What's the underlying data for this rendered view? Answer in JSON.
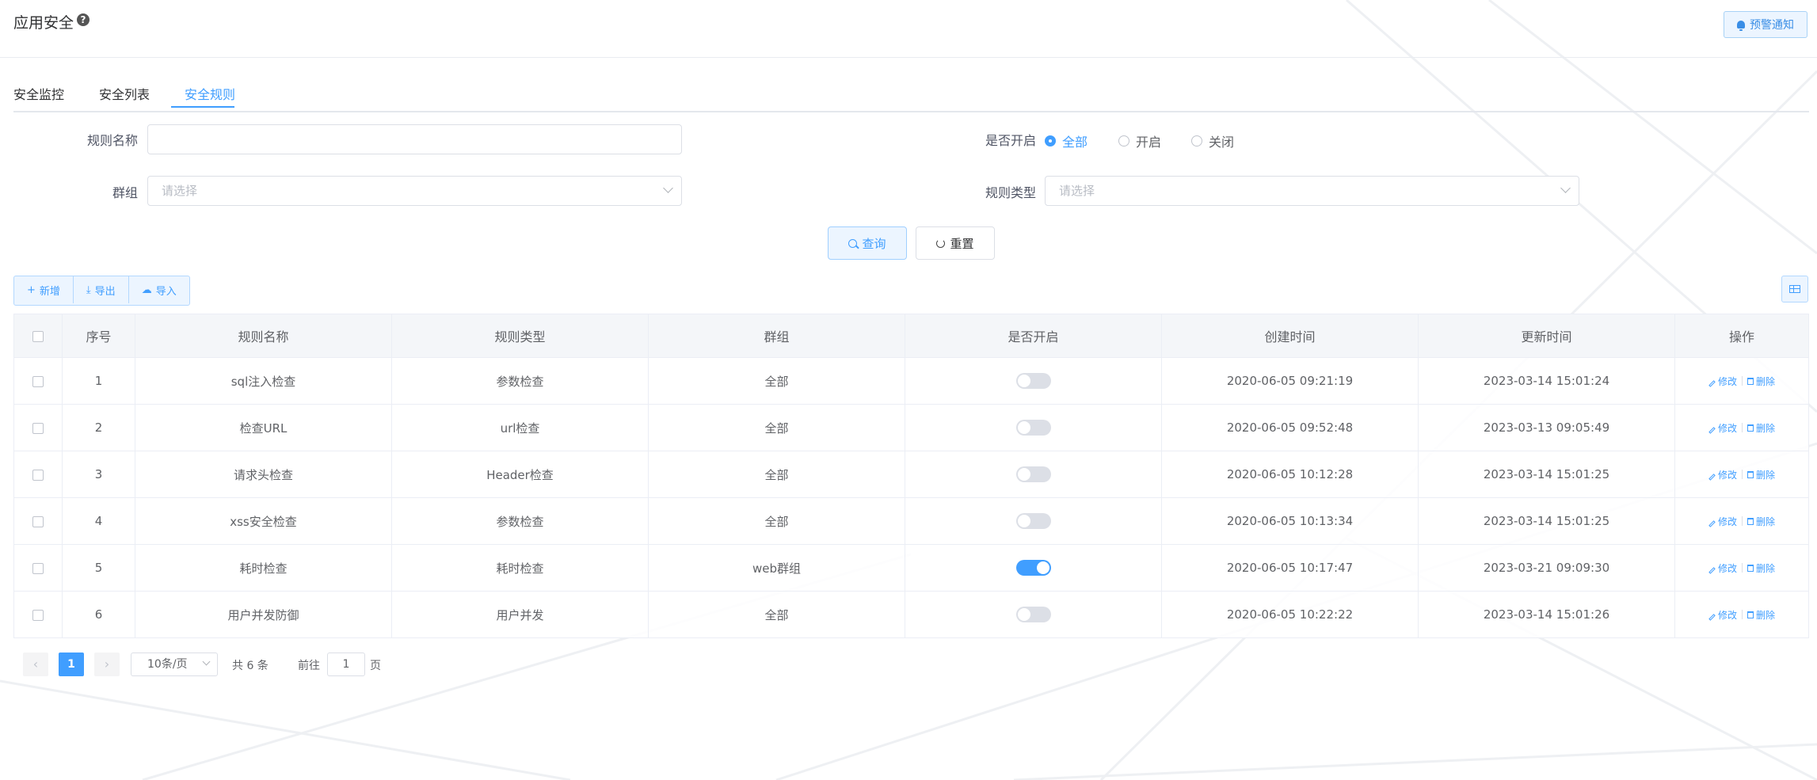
{
  "header": {
    "title": "应用安全",
    "alert_button": "预警通知"
  },
  "tabs": [
    {
      "label": "安全监控",
      "active": false
    },
    {
      "label": "安全列表",
      "active": false
    },
    {
      "label": "安全规则",
      "active": true
    }
  ],
  "form": {
    "rule_name_label": "规则名称",
    "rule_name_value": "",
    "group_label": "群组",
    "group_placeholder": "请选择",
    "enabled_label": "是否开启",
    "enabled_options": [
      "全部",
      "开启",
      "关闭"
    ],
    "enabled_selected": "全部",
    "rule_type_label": "规则类型",
    "rule_type_placeholder": "请选择",
    "query_button": "查询",
    "reset_button": "重置"
  },
  "toolbar": {
    "add": "新增",
    "export": "导出",
    "import": "导入"
  },
  "table": {
    "headers": [
      "序号",
      "规则名称",
      "规则类型",
      "群组",
      "是否开启",
      "创建时间",
      "更新时间",
      "操作"
    ],
    "edit_label": "修改",
    "delete_label": "删除",
    "rows": [
      {
        "no": "1",
        "name": "sql注入检查",
        "type": "参数检查",
        "group": "全部",
        "enabled": false,
        "created": "2020-06-05 09:21:19",
        "updated": "2023-03-14 15:01:24"
      },
      {
        "no": "2",
        "name": "检查URL",
        "type": "url检查",
        "group": "全部",
        "enabled": false,
        "created": "2020-06-05 09:52:48",
        "updated": "2023-03-13 09:05:49"
      },
      {
        "no": "3",
        "name": "请求头检查",
        "type": "Header检查",
        "group": "全部",
        "enabled": false,
        "created": "2020-06-05 10:12:28",
        "updated": "2023-03-14 15:01:25"
      },
      {
        "no": "4",
        "name": "xss安全检查",
        "type": "参数检查",
        "group": "全部",
        "enabled": false,
        "created": "2020-06-05 10:13:34",
        "updated": "2023-03-14 15:01:25"
      },
      {
        "no": "5",
        "name": "耗时检查",
        "type": "耗时检查",
        "group": "web群组",
        "enabled": true,
        "created": "2020-06-05 10:17:47",
        "updated": "2023-03-21 09:09:30"
      },
      {
        "no": "6",
        "name": "用户并发防御",
        "type": "用户并发",
        "group": "全部",
        "enabled": false,
        "created": "2020-06-05 10:22:22",
        "updated": "2023-03-14 15:01:26"
      }
    ]
  },
  "pagination": {
    "current_page": "1",
    "page_size": "10条/页",
    "total_text": "共 6 条",
    "goto_prefix": "前往",
    "goto_value": "1",
    "goto_suffix": "页"
  },
  "colors": {
    "primary": "#409eff",
    "border": "#ebeef5",
    "header_bg": "#f4f6f9"
  }
}
